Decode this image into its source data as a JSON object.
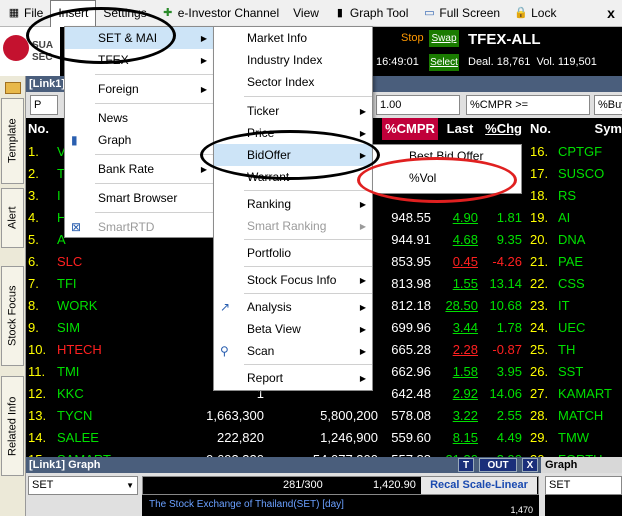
{
  "menubar": {
    "items": [
      {
        "label": "File"
      },
      {
        "label": "Insert"
      },
      {
        "label": "Settings"
      },
      {
        "label": "e-Investor Channel"
      },
      {
        "label": "View"
      },
      {
        "label": "Graph Tool"
      },
      {
        "label": "Full Screen"
      },
      {
        "label": "Lock"
      }
    ],
    "close": "x"
  },
  "logo": {
    "line1": "SUA",
    "line2": "SEC"
  },
  "side_tabs": [
    "Template",
    "Alert",
    "Stock Focus",
    "Related Info"
  ],
  "ticker": {
    "stop": "Stop",
    "swap": "Swap",
    "select": "Select",
    "time": "16:49:01",
    "title": "TFEX-ALL",
    "deal": "Deal. 18,761",
    "vol": "Vol. 119,501"
  },
  "link_bar": {
    "title": "[Link1]"
  },
  "filter": {
    "first": "P",
    "val": "1.00",
    "cmpr": "%CMPR >=",
    "buy": "%Buy"
  },
  "table": {
    "headers": [
      "No.",
      "",
      "",
      "",
      "%CMPR",
      "Last",
      "%Chg",
      "No.",
      "Sym"
    ],
    "left_no": [
      "1.",
      "2.",
      "3.",
      "4.",
      "5.",
      "6.",
      "7.",
      "8.",
      "9.",
      "10.",
      "11.",
      "12.",
      "13.",
      "14.",
      "15."
    ],
    "left_sym": [
      "V",
      "T",
      "I",
      "H",
      "A",
      "SLC",
      "TFI",
      "WORK",
      "SIM",
      "HTECH",
      "TMI",
      "KKC",
      "TYCN",
      "SALEE",
      "SAMART"
    ],
    "col_a": [
      "",
      "",
      "",
      "",
      "",
      "79",
      "29",
      "",
      "5",
      "",
      "",
      "1",
      "1,663,300",
      "222,820",
      "9,693,320"
    ],
    "col_b": [
      "",
      "",
      "",
      "",
      "",
      "",
      "",
      "",
      "",
      "",
      "",
      "",
      "5,800,200",
      "1,246,900",
      "54,077,300"
    ],
    "cmpr": [
      "",
      "",
      "",
      "",
      "948.55",
      "944.91",
      "853.95",
      "813.98",
      "812.18",
      "699.96",
      "665.28",
      "662.96",
      "642.48",
      "578.08",
      "559.60",
      "557.88"
    ],
    "last": [
      "",
      "",
      "",
      "",
      "4.90",
      "4.68",
      "0.45",
      "1.55",
      "28.50",
      "3.44",
      "2.28",
      "1.58",
      "2.92",
      "3.22",
      "8.15",
      "21.30"
    ],
    "chg": [
      "49",
      "50",
      "82",
      "",
      "1.81",
      "9.35",
      "-4.26",
      "13.14",
      "10.68",
      "1.78",
      "-0.87",
      "3.95",
      "14.06",
      "2.55",
      "4.49",
      "3.90"
    ],
    "right_no": [
      "16.",
      "17.",
      "18.",
      "19.",
      "20.",
      "21.",
      "22.",
      "23.",
      "24.",
      "25.",
      "26.",
      "27.",
      "28.",
      "29.",
      "30."
    ],
    "right_sym": [
      "CPTGF",
      "SUSCO",
      "RS",
      "AI",
      "DNA",
      "PAE",
      "CSS",
      "IT",
      "UEC",
      "TH",
      "SST",
      "KAMART",
      "MATCH",
      "TMW",
      "FORTH"
    ]
  },
  "graph": {
    "title": "[Link1] Graph",
    "t": "T",
    "out": "OUT",
    "x": "X",
    "select": "SET",
    "range": "281/300",
    "price": "1,420.90",
    "recal": "Recal Scale-Linear",
    "caption": "The Stock Exchange of Thailand(SET) [day]",
    "title2": "Graph",
    "select2": "SET",
    "tick": "1,470"
  },
  "insert_menu": {
    "items": [
      "SET & MAI",
      "TFEX",
      "Foreign",
      "News",
      "Graph",
      "Bank Rate",
      "Smart Browser",
      "SmartRTD"
    ]
  },
  "set_menu": {
    "items": [
      "Market Info",
      "Industry Index",
      "Sector Index",
      "Ticker",
      "Price",
      "BidOffer",
      "Warrant",
      "Ranking",
      "Smart Ranking",
      "Portfolio",
      "Stock Focus Info",
      "Analysis",
      "Beta View",
      "Scan",
      "Report"
    ]
  },
  "bid_menu": {
    "items": [
      "Best Bid Offer",
      "%Vol"
    ]
  }
}
